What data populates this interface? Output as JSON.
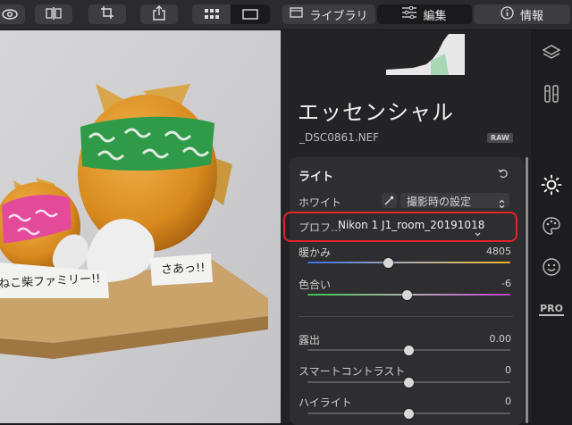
{
  "topbar": {
    "library_label": "ライブラリ",
    "edit_label": "編集",
    "info_label": "情報"
  },
  "photo": {
    "sign_left": "ねこ柴ファミリー!!",
    "sign_right": "さあっ!!"
  },
  "panel": {
    "title": "エッセンシャル",
    "filename": "_DSC0861.NEF",
    "raw_badge": "RAW",
    "card": {
      "section_title": "ライト",
      "white_label": "ホワイト",
      "white_value": "撮影時の設定",
      "profile_label": "プロフ…",
      "profile_value": "Nikon 1 J1_room_20191018",
      "sliders": [
        {
          "label": "暖かみ",
          "value": "4805",
          "level": 0.4
        },
        {
          "label": "色合い",
          "value": "-6",
          "level": 0.49
        },
        {
          "label": "露出",
          "value": "0.00",
          "level": 0.5
        },
        {
          "label": "スマートコントラスト",
          "value": "0",
          "level": 0.5
        },
        {
          "label": "ハイライト",
          "value": "0",
          "level": 0.5
        }
      ]
    }
  },
  "right_sidebar": {
    "pro_label": "PRO"
  },
  "colors": {
    "accent_highlight": "#e0242b",
    "active_icon": "#ffffff"
  }
}
